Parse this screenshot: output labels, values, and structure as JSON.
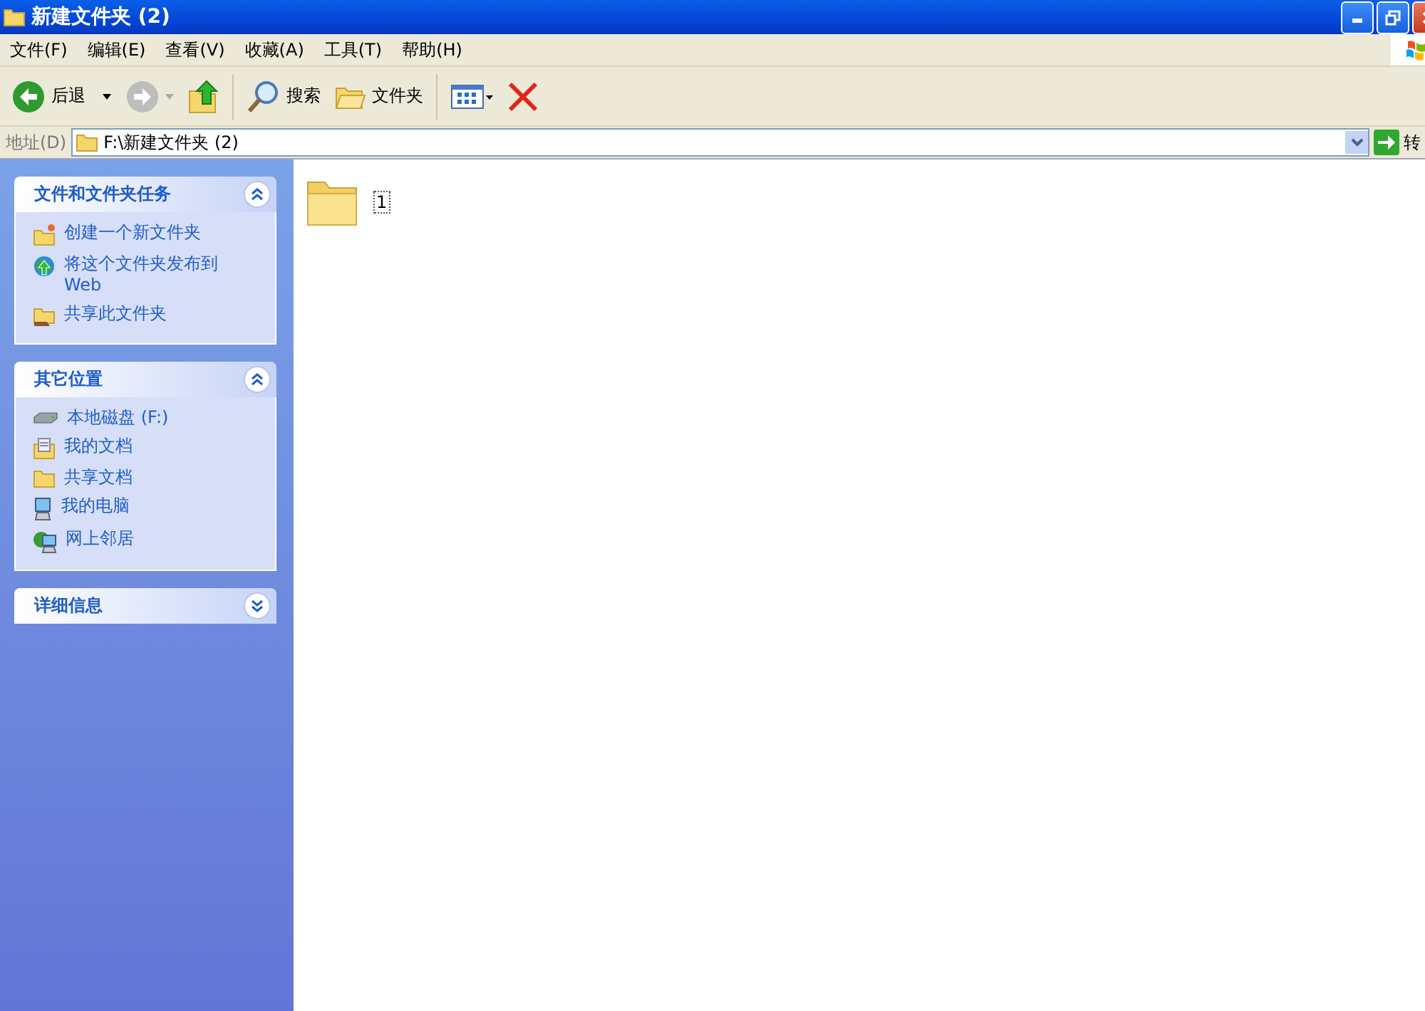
{
  "window": {
    "title": "新建文件夹 (2)"
  },
  "menu": [
    "文件(F)",
    "编辑(E)",
    "查看(V)",
    "收藏(A)",
    "工具(T)",
    "帮助(H)"
  ],
  "toolbar": {
    "back": "后退",
    "search": "搜索",
    "folders": "文件夹"
  },
  "address": {
    "label": "地址(D)",
    "value": "F:\\新建文件夹 (2)",
    "go": "转"
  },
  "panels": [
    {
      "title": "文件和文件夹任务",
      "expanded": true,
      "items": [
        {
          "kind": "new-folder",
          "label": "创建一个新文件夹"
        },
        {
          "kind": "publish",
          "label": "将这个文件夹发布到 Web"
        },
        {
          "kind": "share",
          "label": "共享此文件夹"
        }
      ]
    },
    {
      "title": "其它位置",
      "expanded": true,
      "items": [
        {
          "kind": "drive",
          "label": "本地磁盘 (F:)"
        },
        {
          "kind": "documents",
          "label": "我的文档"
        },
        {
          "kind": "folder",
          "label": "共享文档"
        },
        {
          "kind": "computer",
          "label": "我的电脑"
        },
        {
          "kind": "network",
          "label": "网上邻居"
        }
      ]
    },
    {
      "title": "详细信息",
      "expanded": false
    }
  ],
  "files": [
    {
      "name": "1",
      "selected": true
    }
  ]
}
